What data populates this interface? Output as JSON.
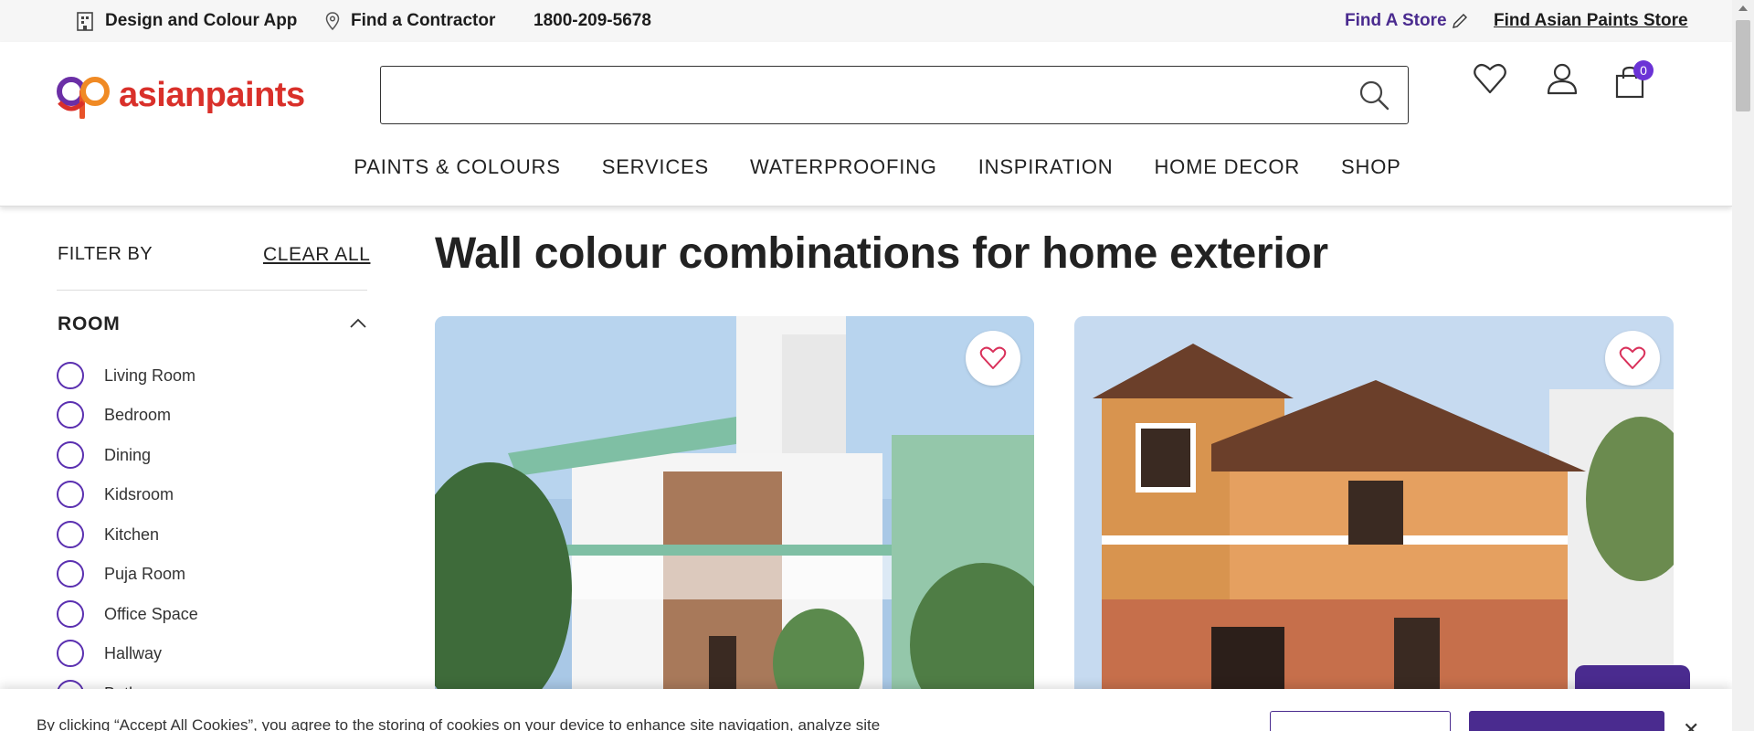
{
  "topbar": {
    "design_app": "Design and Colour App",
    "find_contractor": "Find a Contractor",
    "phone": "1800-209-5678",
    "find_store": "Find A Store",
    "find_ap_store": "Find Asian Paints Store"
  },
  "header": {
    "logo_text": "asianpaints",
    "search_placeholder": "",
    "cart_count": "0",
    "nav": [
      "PAINTS & COLOURS",
      "SERVICES",
      "WATERPROOFING",
      "INSPIRATION",
      "HOME DECOR",
      "SHOP"
    ]
  },
  "filter": {
    "title": "FILTER BY",
    "clear_all": "CLEAR ALL",
    "room_title": "ROOM",
    "rooms": [
      "Living Room",
      "Bedroom",
      "Dining",
      "Kidsroom",
      "Kitchen",
      "Puja Room",
      "Office Space",
      "Hallway",
      "Bathroom"
    ]
  },
  "main": {
    "title": "Wall colour combinations for home exterior"
  },
  "cookie": {
    "text": "By clicking “Accept All Cookies”, you agree to the storing of cookies on your device to enhance site navigation, analyze site"
  },
  "colors": {
    "brand_purple": "#4a2b8f",
    "brand_red": "#d9302a"
  }
}
